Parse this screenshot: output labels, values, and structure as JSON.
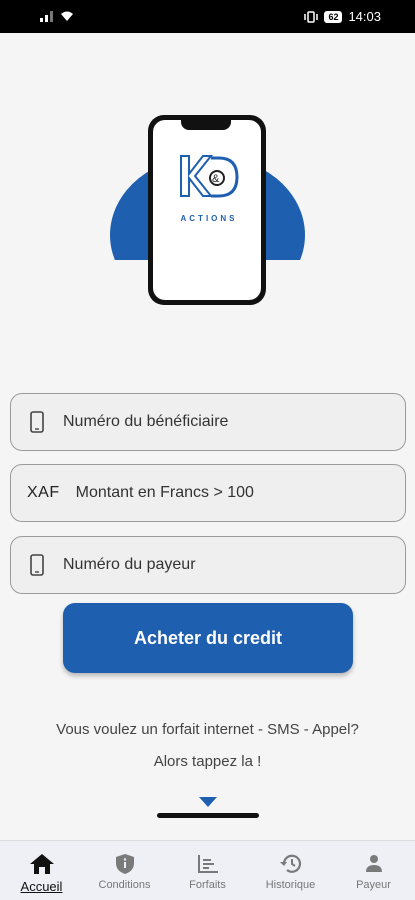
{
  "status_bar": {
    "time": "14:03",
    "battery": "62"
  },
  "brand": {
    "logo_text": "K&D",
    "logo_subtitle": "ACTIONS"
  },
  "form": {
    "beneficiary_placeholder": "Numéro du bénéficiaire",
    "currency_prefix": "XAF",
    "amount_placeholder": "Montant en Francs > 100",
    "payer_placeholder": "Numéro du payeur",
    "submit_label": "Acheter du credit"
  },
  "promo": {
    "line1": "Vous voulez un forfait internet - SMS - Appel?",
    "line2": "Alors tappez la !"
  },
  "nav": {
    "items": [
      {
        "label": "Accueil",
        "icon": "home-icon",
        "active": true
      },
      {
        "label": "Conditions",
        "icon": "shield-icon",
        "active": false
      },
      {
        "label": "Forfaits",
        "icon": "chart-icon",
        "active": false
      },
      {
        "label": "Historique",
        "icon": "history-icon",
        "active": false
      },
      {
        "label": "Payeur",
        "icon": "person-icon",
        "active": false
      }
    ]
  },
  "colors": {
    "primary": "#1f5fb0",
    "background": "#f5f5f5"
  }
}
